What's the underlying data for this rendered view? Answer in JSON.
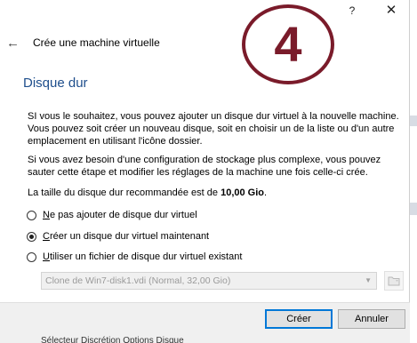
{
  "window": {
    "help_symbol": "?",
    "close_symbol": "✕",
    "back_symbol": "←",
    "title": "Crée une machine virtuelle"
  },
  "stamp": {
    "number": "4",
    "color": "#7a1b2a"
  },
  "page": {
    "heading": "Disque dur",
    "paragraph1": "SI vous le souhaitez, vous pouvez ajouter un disque dur virtuel à la nouvelle machine. Vous pouvez soit créer un nouveau disque, soit en choisir un de la liste ou d'un autre emplacement en utilisant l'icône dossier.",
    "paragraph2": "Si vous avez besoin d'une configuration de stockage plus complexe, vous pouvez sauter cette étape et modifier les réglages de la machine une fois celle-ci crée.",
    "recommend_prefix": "La taille du disque dur recommandée est de ",
    "recommend_value": "10,00 Gio",
    "recommend_suffix": "."
  },
  "options": [
    {
      "accel": "N",
      "rest": "e pas ajouter de disque dur virtuel",
      "checked": false
    },
    {
      "accel": "C",
      "rest": "réer un disque dur virtuel maintenant",
      "checked": true
    },
    {
      "accel": "U",
      "rest": "tiliser un fichier de disque dur virtuel existant",
      "checked": false
    }
  ],
  "disk_select": {
    "value": "Clone de Win7-disk1.vdi (Normal, 32,00 Gio)",
    "arrow": "▼"
  },
  "buttons": {
    "create": "Créer",
    "cancel": "Annuler"
  },
  "colors": {
    "heading": "#1e4e8c",
    "primary_border": "#0078d7"
  },
  "background_text": "Sélecteur    Discrétion  Options  Disque"
}
